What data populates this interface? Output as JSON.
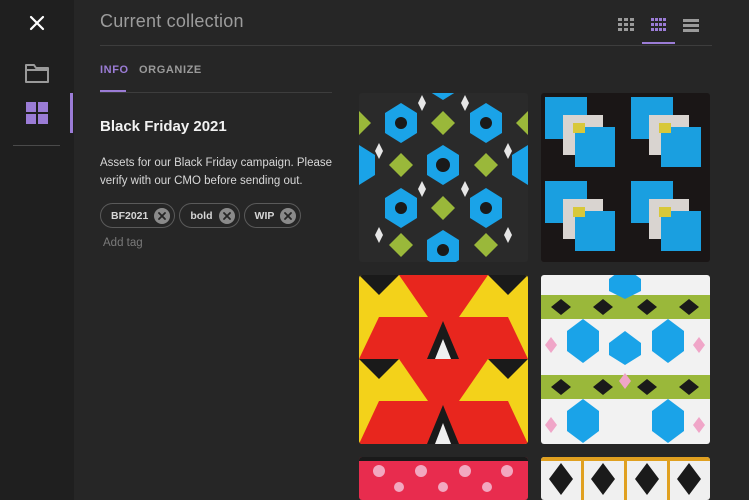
{
  "header": {
    "title": "Current collection",
    "views": [
      {
        "name": "large-grid",
        "active": false
      },
      {
        "name": "small-grid",
        "active": true
      },
      {
        "name": "list",
        "active": false
      }
    ]
  },
  "rail": {
    "items": [
      {
        "icon": "close-icon"
      },
      {
        "icon": "folder-icon"
      },
      {
        "icon": "grid-icon",
        "active": true
      }
    ]
  },
  "tabs": [
    {
      "label": "INFO",
      "active": true
    },
    {
      "label": "ORGANIZE",
      "active": false
    }
  ],
  "collection": {
    "title": "Black Friday 2021",
    "description": "Assets for our Black Friday campaign. Please verify with our CMO before sending out.",
    "tags": [
      "BF2021",
      "bold",
      "WIP"
    ],
    "add_tag_label": "Add tag"
  },
  "assets": [
    {
      "pattern": "blue-green-kaleidoscope"
    },
    {
      "pattern": "blue-squares-on-black"
    },
    {
      "pattern": "red-yellow-triangles"
    },
    {
      "pattern": "green-blue-hexagons"
    },
    {
      "pattern": "red-pink-flowers"
    },
    {
      "pattern": "black-white-pinwheels"
    }
  ],
  "colors": {
    "accent": "#9b7cd6",
    "rail_bg": "#1f1f1f",
    "panel_bg": "#262626"
  }
}
